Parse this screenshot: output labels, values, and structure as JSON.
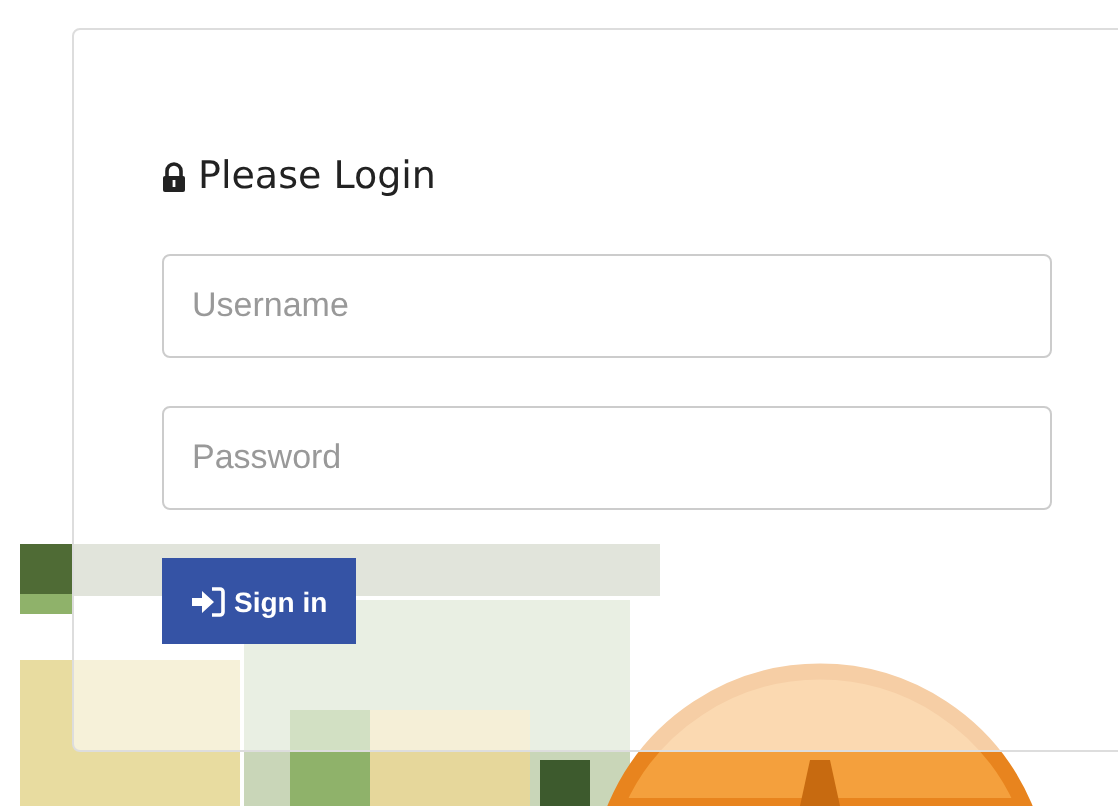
{
  "panel": {
    "title": "Please Login"
  },
  "fields": [
    {
      "placeholder": "Username"
    },
    {
      "placeholder": "Password"
    }
  ],
  "button": {
    "label": "Sign in"
  }
}
